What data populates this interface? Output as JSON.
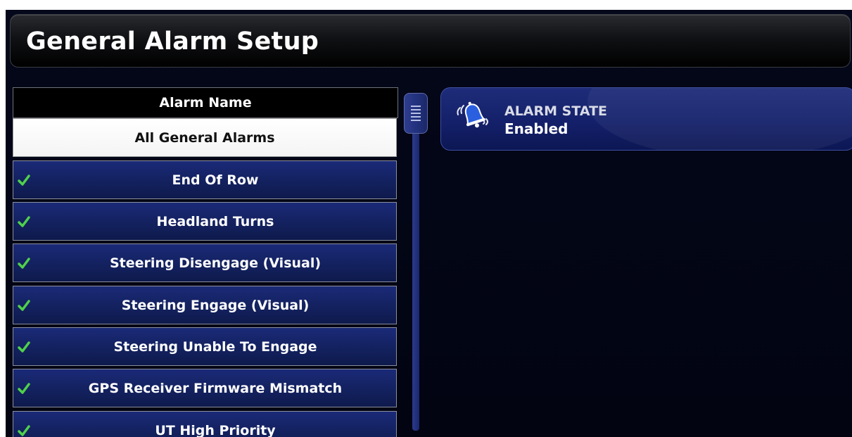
{
  "header": {
    "title": "General Alarm Setup"
  },
  "alarm_list": {
    "column_header": "Alarm Name",
    "selected_item": "All General Alarms",
    "items": [
      {
        "label": "End Of Row",
        "checked": true
      },
      {
        "label": "Headland Turns",
        "checked": true
      },
      {
        "label": "Steering Disengage (Visual)",
        "checked": true
      },
      {
        "label": "Steering Engage (Visual)",
        "checked": true
      },
      {
        "label": "Steering Unable To Engage",
        "checked": true
      },
      {
        "label": "GPS Receiver Firmware Mismatch",
        "checked": true
      },
      {
        "label": "UT High Priority",
        "checked": true
      }
    ]
  },
  "alarm_state": {
    "icon": "alarm-bell-icon",
    "title": "ALARM STATE",
    "value": "Enabled"
  },
  "colors": {
    "row_blue": "#13215f",
    "check_green": "#4fd14a",
    "bell_blue": "#2a5fe0"
  }
}
